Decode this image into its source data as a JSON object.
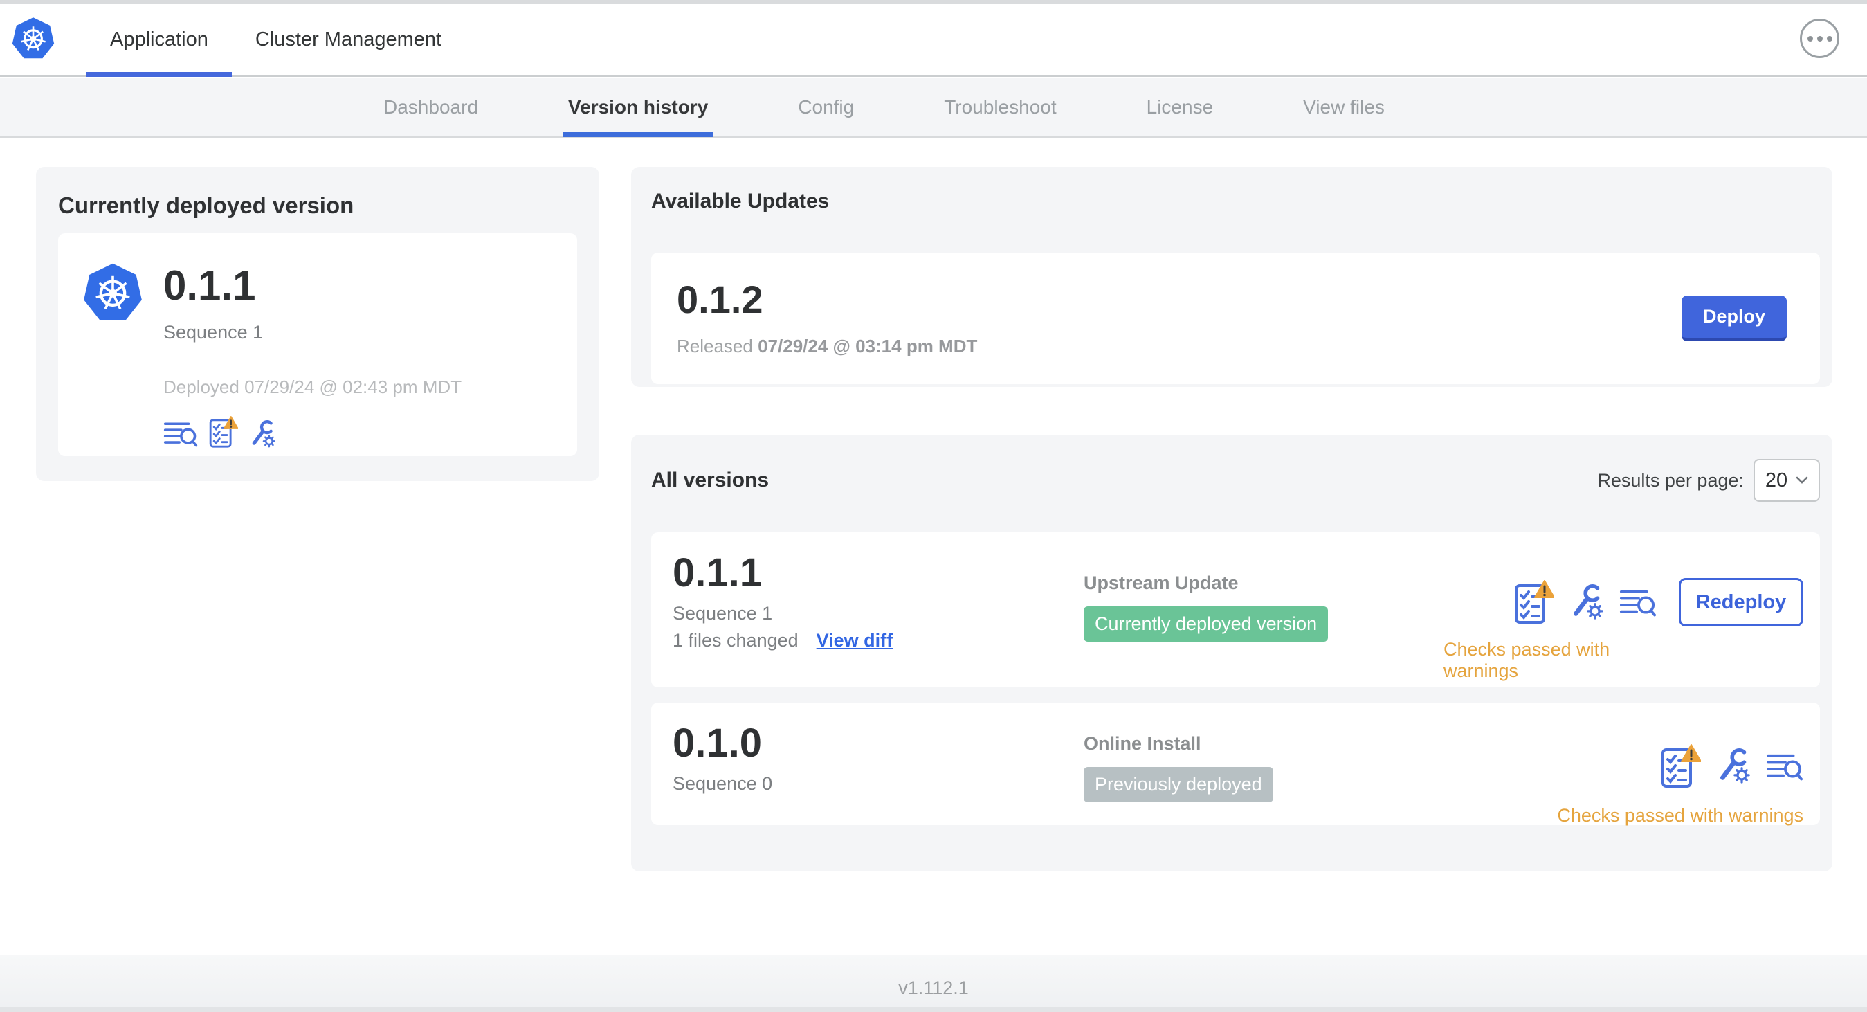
{
  "header": {
    "tabs": [
      {
        "label": "Application"
      },
      {
        "label": "Cluster Management"
      }
    ],
    "menu_icon": "ellipsis-icon",
    "logo_icon": "kubernetes-helm-wheel"
  },
  "subnav": {
    "tabs": [
      "Dashboard",
      "Version history",
      "Config",
      "Troubleshoot",
      "License",
      "View files"
    ],
    "active_tab": "Version history"
  },
  "current_version": {
    "title": "Currently deployed version",
    "version": "0.1.1",
    "sequence": "Sequence 1",
    "deployed": "Deployed 07/29/24 @ 02:43 pm MDT",
    "icons": [
      "release-notes-icon",
      "preflight-checks-warning-icon",
      "edit-config-icon"
    ]
  },
  "available_updates": {
    "title": "Available Updates",
    "version": "0.1.2",
    "released_prefix": "Released",
    "released_date": "07/29/24 @ 03:14 pm MDT",
    "deploy_label": "Deploy"
  },
  "all_versions": {
    "title": "All versions",
    "results_per_page_label": "Results per page:",
    "results_per_page_value": "20",
    "rows": [
      {
        "version": "0.1.1",
        "sequence": "Sequence 1",
        "files_changed": "1 files changed",
        "view_diff_label": "View diff",
        "source": "Upstream Update",
        "badge": "Currently deployed version",
        "badge_color": "#6ac497",
        "checks": "Checks passed with warnings",
        "action_label": "Redeploy",
        "icons": [
          "preflight-checks-warning-icon",
          "edit-config-icon",
          "release-notes-icon"
        ]
      },
      {
        "version": "0.1.0",
        "sequence": "Sequence 0",
        "source": "Online Install",
        "badge": "Previously deployed",
        "badge_color": "#b7c0c3",
        "checks": "Checks passed with warnings",
        "icons": [
          "preflight-checks-warning-icon",
          "edit-config-icon",
          "release-notes-icon"
        ]
      }
    ]
  },
  "footer": {
    "app_version": "v1.112.1"
  },
  "colors": {
    "accent_blue": "#4065dc",
    "icon_blue": "#4a71dc",
    "kubernetes_blue": "#326de6",
    "warning_amber": "#e5a43e",
    "success_badge": "#6ac497",
    "neutral_badge": "#b7c0c3",
    "panel_bg": "#f4f5f7"
  }
}
